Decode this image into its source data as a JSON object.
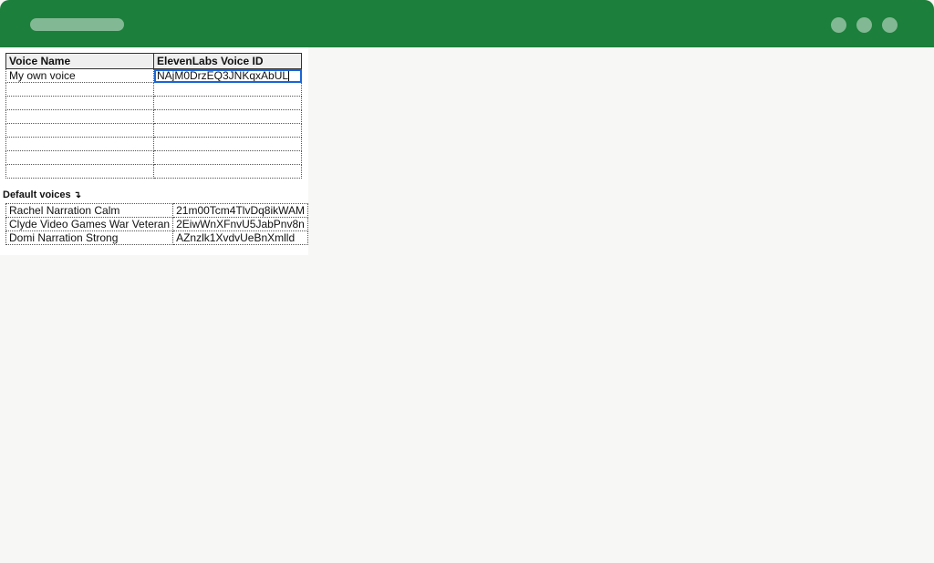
{
  "window": {
    "controls": [
      "dot",
      "dot",
      "dot"
    ]
  },
  "sheet": {
    "headers": {
      "voice_name": "Voice Name",
      "voice_id": "ElevenLabs Voice ID"
    },
    "custom_rows": [
      {
        "name": "My own voice",
        "id": "NAjM0DrzEQ3JNKqxAbUL"
      },
      {
        "name": "",
        "id": ""
      },
      {
        "name": "",
        "id": ""
      },
      {
        "name": "",
        "id": ""
      },
      {
        "name": "",
        "id": ""
      },
      {
        "name": "",
        "id": ""
      },
      {
        "name": "",
        "id": ""
      },
      {
        "name": "",
        "id": ""
      }
    ],
    "default_section": {
      "label": "Default voices",
      "arrow_icon": "return-arrow-icon",
      "rows": [
        {
          "name": "Rachel Narration Calm",
          "id": "21m00Tcm4TlvDq8ikWAM"
        },
        {
          "name": "Clyde Video Games War Veteran",
          "id": "2EiwWnXFnvU5JabPnv8n"
        },
        {
          "name": "Domi Narration Strong",
          "id": "AZnzlk1XvdvUeBnXmlld"
        }
      ]
    }
  },
  "colors": {
    "titlebar": "#1c7f3b",
    "background": "#f7f8f6",
    "active_cell": "#1a66d6"
  }
}
